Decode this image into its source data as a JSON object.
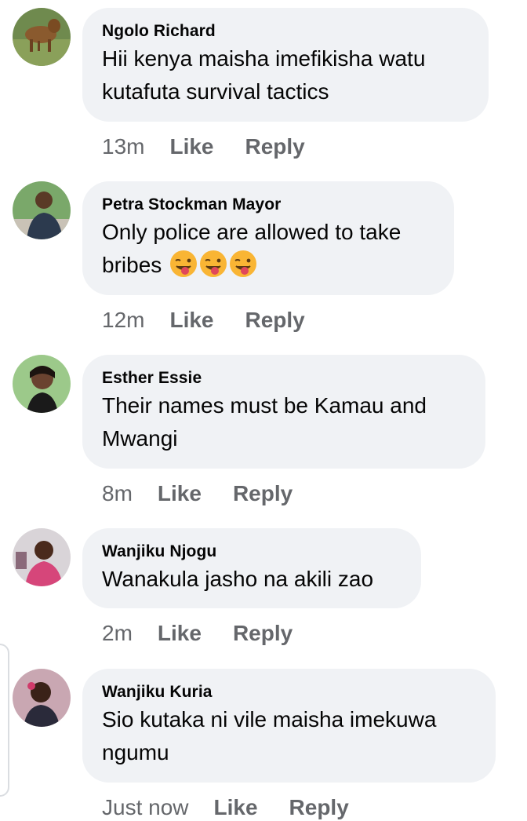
{
  "comments": [
    {
      "author": "Ngolo Richard",
      "text": "Hii kenya maisha imefikisha watu kutafuta survival tactics",
      "time": "13m",
      "like_label": "Like",
      "reply_label": "Reply",
      "avatar_icon": "dog-photo-avatar"
    },
    {
      "author": "Petra Stockman Mayor",
      "text": "Only police are allowed to take bribes",
      "emoji": [
        "winking-tongue-face",
        "winking-tongue-face",
        "winking-tongue-face"
      ],
      "time": "12m",
      "like_label": "Like",
      "reply_label": "Reply",
      "avatar_icon": "person-photo-avatar"
    },
    {
      "author": "Esther Essie",
      "text": "Their names must be Kamau and Mwangi",
      "time": "8m",
      "like_label": "Like",
      "reply_label": "Reply",
      "avatar_icon": "person-photo-avatar"
    },
    {
      "author": "Wanjiku Njogu",
      "text": "Wanakula jasho na akili zao",
      "time": "2m",
      "like_label": "Like",
      "reply_label": "Reply",
      "avatar_icon": "person-photo-avatar"
    },
    {
      "author": "Wanjiku Kuria",
      "text": "Sio kutaka ni vile maisha imekuwa ngumu",
      "time": "Just now",
      "like_label": "Like",
      "reply_label": "Reply",
      "avatar_icon": "person-photo-avatar"
    }
  ],
  "colors": {
    "bubble": "#f0f2f5",
    "name": "#050505",
    "meta": "#65676b"
  }
}
